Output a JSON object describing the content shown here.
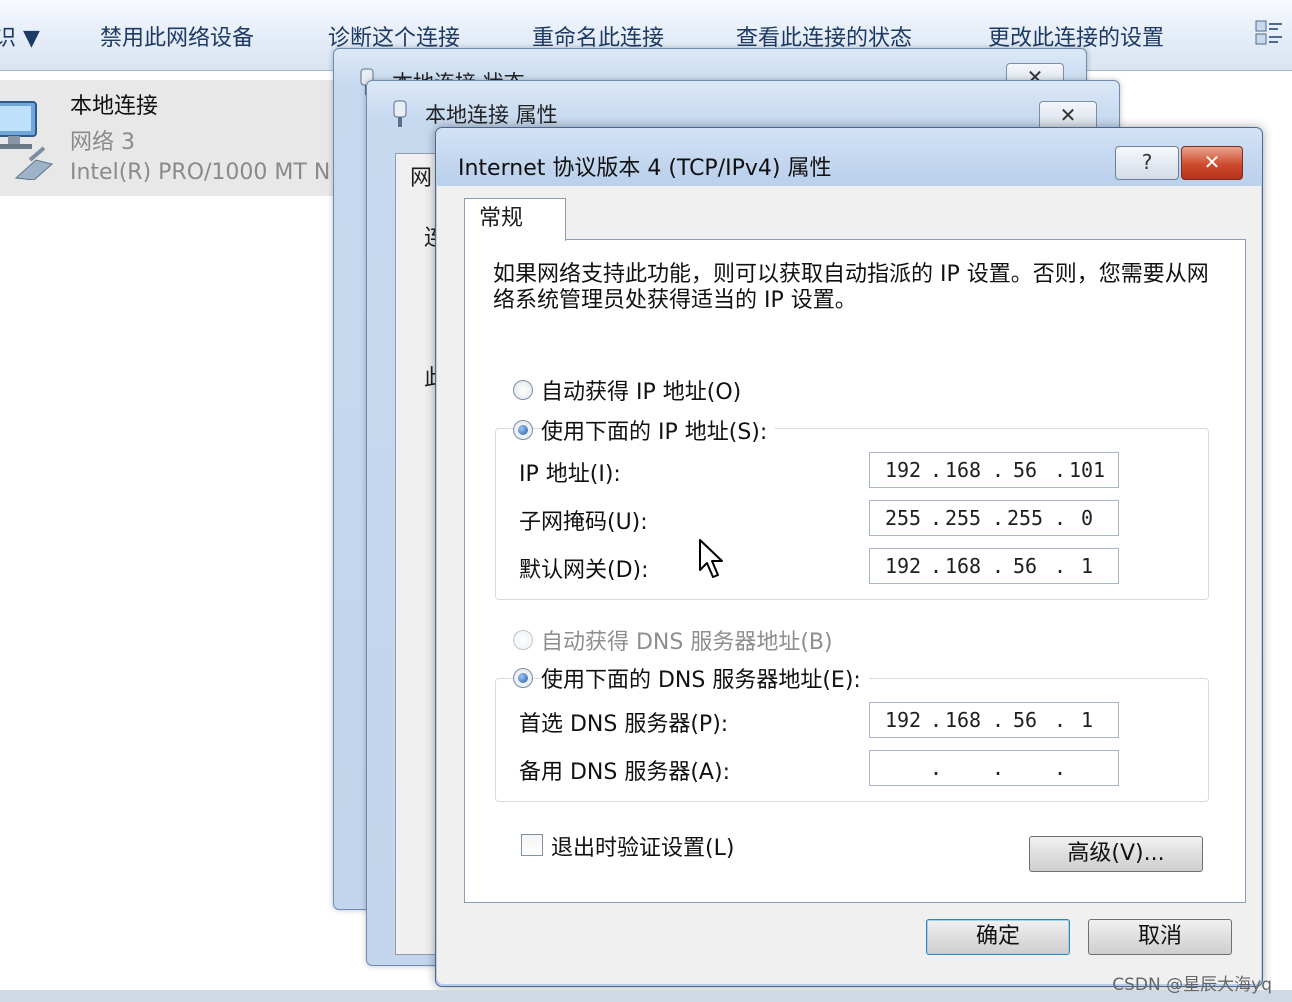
{
  "toolbar": {
    "items": [
      "识 ▼",
      "禁用此网络设备",
      "诊断这个连接",
      "重命名此连接",
      "查看此连接的状态",
      "更改此连接的设置"
    ],
    "view_icon": "view-options-icon"
  },
  "adapter": {
    "name": "本地连接",
    "network": "网络 3",
    "device": "Intel(R) PRO/1000 MT N",
    "icon": "network-adapter-icon"
  },
  "status_window": {
    "title": "本地连接 状态",
    "close": "✕"
  },
  "properties_window": {
    "title": "本地连接 属性",
    "close": "✕",
    "tab": "网",
    "side_chars": [
      "连",
      "此"
    ]
  },
  "dialog": {
    "title": "Internet 协议版本 4 (TCP/IPv4) 属性",
    "help_label": "?",
    "close_label": "✕",
    "tab": "常规",
    "description": "如果网络支持此功能，则可以获取自动指派的 IP 设置。否则，您需要从网络系统管理员处获得适当的 IP 设置。",
    "ip_auto": {
      "label": "自动获得 IP 地址(O)",
      "selected": false
    },
    "ip_manual": {
      "label": "使用下面的 IP 地址(S):",
      "selected": true
    },
    "ip_address": {
      "label": "IP 地址(I):",
      "octets": [
        "192",
        "168",
        "56",
        "101"
      ]
    },
    "subnet_mask": {
      "label": "子网掩码(U):",
      "octets": [
        "255",
        "255",
        "255",
        "0"
      ]
    },
    "gateway": {
      "label": "默认网关(D):",
      "octets": [
        "192",
        "168",
        "56",
        "1"
      ]
    },
    "dns_auto": {
      "label": "自动获得 DNS 服务器地址(B)",
      "selected": false,
      "disabled": true
    },
    "dns_manual": {
      "label": "使用下面的 DNS 服务器地址(E):",
      "selected": true
    },
    "preferred_dns": {
      "label": "首选 DNS 服务器(P):",
      "octets": [
        "192",
        "168",
        "56",
        "1"
      ]
    },
    "alternate_dns": {
      "label": "备用 DNS 服务器(A):",
      "octets": [
        "",
        "",
        "",
        ""
      ]
    },
    "validate_on_exit": {
      "label": "退出时验证设置(L)",
      "checked": false
    },
    "advanced_button": "高级(V)...",
    "ok_button": "确定",
    "cancel_button": "取消"
  },
  "watermark": "CSDN @星辰大海yq"
}
